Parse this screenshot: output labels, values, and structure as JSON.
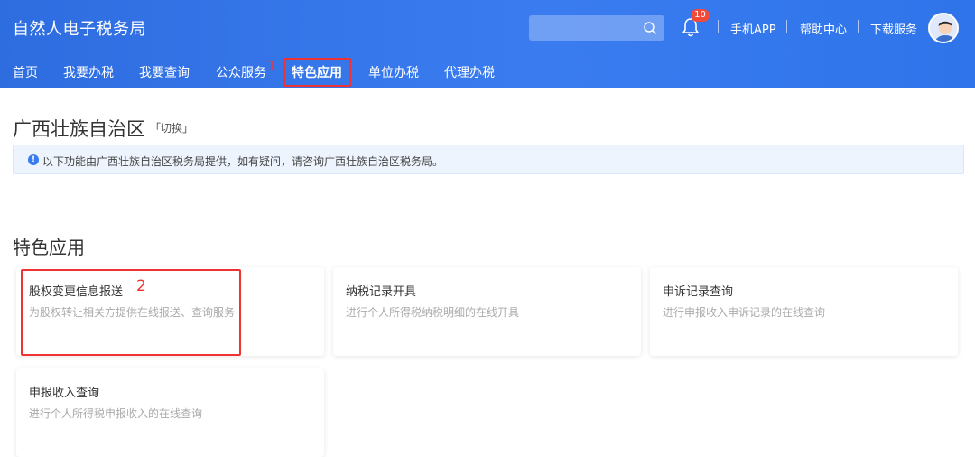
{
  "header": {
    "app_title": "自然人电子税务局",
    "search_placeholder": "",
    "notification_count": "10",
    "links": [
      "手机APP",
      "帮助中心",
      "下载服务"
    ]
  },
  "nav": {
    "items": [
      "首页",
      "我要办税",
      "我要查询",
      "公众服务",
      "特色应用",
      "单位办税",
      "代理办税"
    ],
    "active": "特色应用"
  },
  "annotations": {
    "step1": "1",
    "step2": "2"
  },
  "region": {
    "title": "广西壮族自治区",
    "switch_label": "「切换」"
  },
  "notice": {
    "icon": "info-icon",
    "text": "以下功能由广西壮族自治区税务局提供，如有疑问，请咨询广西壮族自治区税务局。"
  },
  "section": {
    "title": "特色应用"
  },
  "cards": [
    {
      "title": "股权变更信息报送",
      "desc": "为股权转让相关方提供在线报送、查询服务"
    },
    {
      "title": "纳税记录开具",
      "desc": "进行个人所得税纳税明细的在线开具"
    },
    {
      "title": "申诉记录查询",
      "desc": "进行申报收入申诉记录的在线查询"
    },
    {
      "title": "申报收入查询",
      "desc": "进行个人所得税申报收入的在线查询"
    }
  ],
  "colors": {
    "header_blue": "#3a7cf0",
    "highlight_red": "#f03232"
  }
}
